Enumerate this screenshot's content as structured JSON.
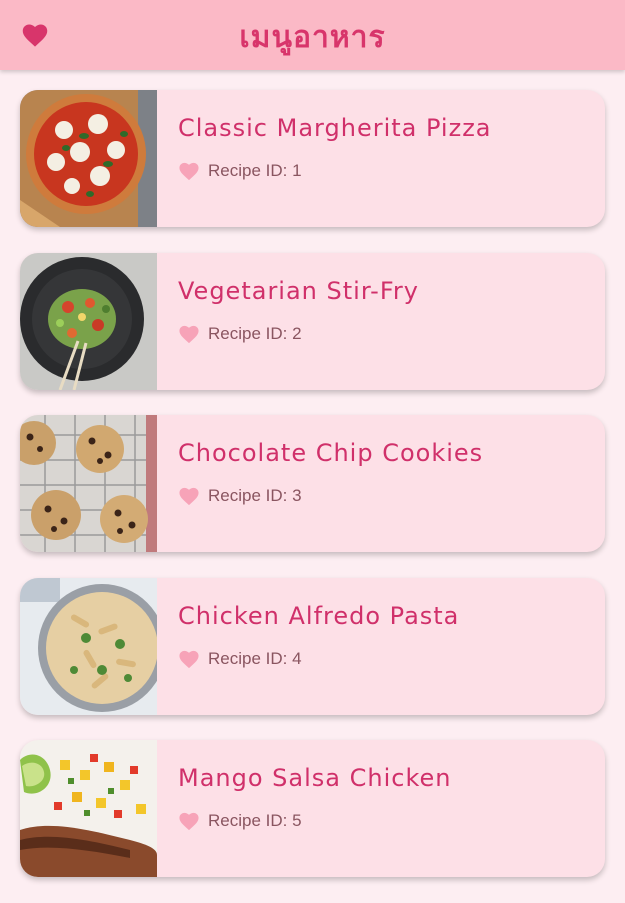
{
  "appbar": {
    "title": "เมนูอาหาร",
    "icon": "heart-icon",
    "accent": "#d8356b",
    "background": "#fbb9c6"
  },
  "recipes": [
    {
      "name": "Classic Margherita Pizza",
      "id_label": "Recipe ID: 1",
      "image": "pizza"
    },
    {
      "name": "Vegetarian Stir-Fry",
      "id_label": "Recipe ID: 2",
      "image": "stir-fry"
    },
    {
      "name": "Chocolate Chip Cookies",
      "id_label": "Recipe ID: 3",
      "image": "cookies"
    },
    {
      "name": "Chicken Alfredo Pasta",
      "id_label": "Recipe ID: 4",
      "image": "pasta"
    },
    {
      "name": "Mango Salsa Chicken",
      "id_label": "Recipe ID: 5",
      "image": "mango-salsa-chicken"
    }
  ],
  "colors": {
    "page_bg": "#fdeef2",
    "card_bg": "#fde0e7",
    "title_pink": "#d0306a",
    "heart_light": "#f7a3b8"
  }
}
